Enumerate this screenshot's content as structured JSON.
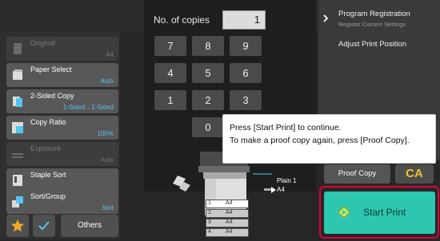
{
  "left_panel": {
    "settings": [
      {
        "label": "Original",
        "value": "A4",
        "enabled": false,
        "icon": "original-icon"
      },
      {
        "label": "Paper Select",
        "value": "Auto",
        "enabled": true,
        "icon": "paper-select-icon"
      },
      {
        "label": "2-Sided Copy",
        "value": "1-Sided→1-Sided",
        "enabled": true,
        "icon": "two-sided-icon"
      },
      {
        "label": "Copy Ratio",
        "value": "100%",
        "enabled": true,
        "icon": "copy-ratio-icon"
      },
      {
        "label": "Exposure",
        "value": "Auto",
        "enabled": false,
        "icon": "exposure-icon"
      },
      {
        "label": "Staple Sort",
        "value": "",
        "enabled": true,
        "icon": "staple-sort-icon"
      },
      {
        "label": "Sort/Group",
        "value": "Sort",
        "enabled": true,
        "icon": "sort-group-icon"
      }
    ],
    "bottom": {
      "others_label": "Others"
    }
  },
  "copies": {
    "label": "No. of copies",
    "value": "1"
  },
  "keypad": [
    "7",
    "8",
    "9",
    "4",
    "5",
    "6",
    "1",
    "2",
    "3",
    "0"
  ],
  "right_panel": {
    "program_registration": "Program Registration",
    "register_current_settings": "Register Current Settings",
    "adjust_print_position": "Adjust Print Position"
  },
  "tooltip": {
    "line1": "Press [Start Print] to continue.",
    "line2": "To make a proof copy again, press [Proof Copy]."
  },
  "machine": {
    "tray_label": "Plain 1",
    "tray_size": "A4",
    "trays": [
      {
        "number": "1",
        "size": "A4"
      },
      {
        "number": "2",
        "size": "A4"
      },
      {
        "number": "3",
        "size": "A4"
      },
      {
        "number": "4",
        "size": "A4"
      }
    ]
  },
  "buttons": {
    "proof_copy": "Proof Copy",
    "ca": "CA",
    "start_print": "Start Print"
  },
  "colors": {
    "accent": "#57c3ef",
    "start": "#2cc7ae",
    "highlight": "#e0003a",
    "ca": "#f2c230"
  }
}
